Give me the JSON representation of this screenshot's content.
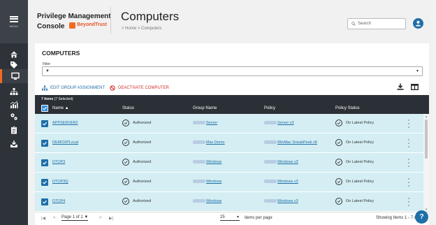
{
  "nav": {
    "menu_label": "MENU",
    "items": [
      {
        "icon": "home-icon",
        "active": false
      },
      {
        "icon": "tag-icon",
        "active": false
      },
      {
        "icon": "monitor-icon",
        "active": true
      },
      {
        "icon": "hierarchy-icon",
        "active": false
      },
      {
        "icon": "analytics-icon",
        "active": false
      },
      {
        "icon": "gears-icon",
        "active": false
      },
      {
        "icon": "clipboard-icon",
        "active": false
      },
      {
        "icon": "deploy-icon",
        "active": false
      }
    ]
  },
  "header": {
    "brand_line1": "Privilege Management",
    "brand_line2": "Console",
    "logo_text": "BeyondTrust",
    "title": "Computers",
    "breadcrumb": "> Home > Computers",
    "search_placeholder": "Search"
  },
  "card": {
    "title": "COMPUTERS",
    "filter_label": "Filter",
    "actions": {
      "assign": "EDIT GROUP ASSIGNMENT",
      "deactivate": "DEACTIVATE COMPUTER"
    }
  },
  "table": {
    "count_bold": "7 items",
    "count_rest": "(7 Selected)",
    "columns": {
      "name": "Name ▲",
      "status": "Status",
      "group": "Group Name",
      "policy": "Policy",
      "policy_status": "Policy Status"
    },
    "rows": [
      {
        "name": "APPSERVER2",
        "status": "Authorized",
        "group": "Server",
        "policy": "Server v3",
        "policy_status": "On Latest Policy"
      },
      {
        "name": "DEMOXPLocal",
        "status": "Authorized",
        "group": "Mac Demo",
        "policy": "WinMac SneakPeek v8",
        "policy_status": "On Latest Policy"
      },
      {
        "name": "DTOP3",
        "status": "Authorized",
        "group": "Windows",
        "policy": "Windows v3",
        "policy_status": "On Latest Policy"
      },
      {
        "name": "DTOP3Q",
        "status": "Authorized",
        "group": "Windows",
        "policy": "Windows v3",
        "policy_status": "On Latest Policy"
      },
      {
        "name": "DTOP4",
        "status": "Authorized",
        "group": "Windows",
        "policy": "Windows v3",
        "policy_status": "On Latest Policy"
      }
    ]
  },
  "pager": {
    "page_label": "Page 1 of 1 ▼",
    "page_size": "25",
    "per_page_label": "items per page",
    "showing": "Showing Items 1 - 7 of 7"
  },
  "help_label": "?",
  "colors": {
    "nav_bg": "#2d3338",
    "accent": "#f26b21",
    "link": "#1e6ea8",
    "danger": "#d0312d",
    "selected_row": "#d4eef3",
    "table_header": "#2a3035"
  }
}
